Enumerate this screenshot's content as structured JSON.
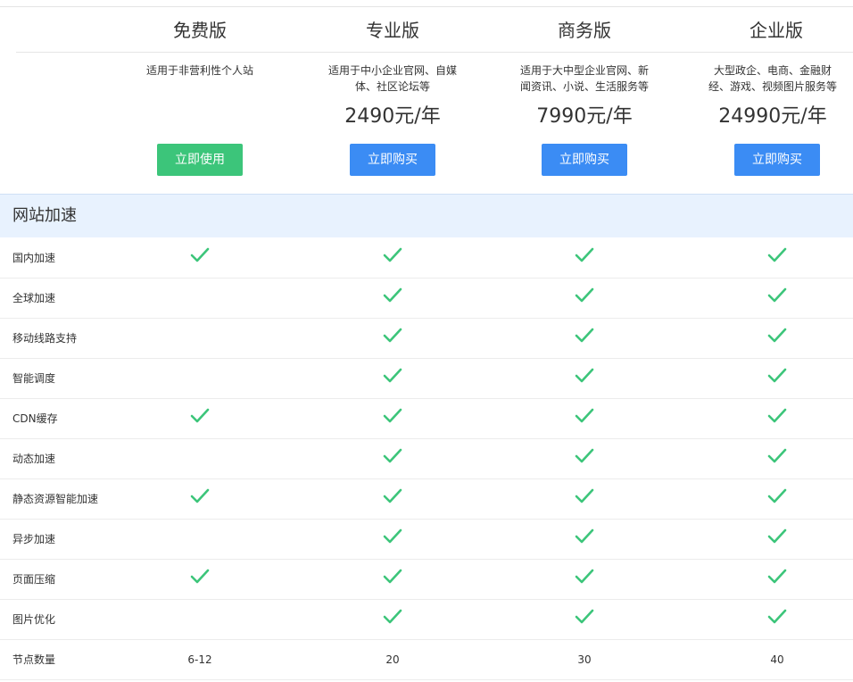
{
  "plans": [
    {
      "name": "免费版",
      "desc_lines": [
        "适用于非营利性个人站"
      ],
      "price": "",
      "button": "立即使用",
      "button_color": "#3cc57a"
    },
    {
      "name": "专业版",
      "desc_lines": [
        "适用于中小企业官网、自媒",
        "体、社区论坛等"
      ],
      "price": "2490元/年",
      "button": "立即购买",
      "button_color": "#3b8cf4"
    },
    {
      "name": "商务版",
      "desc_lines": [
        "适用于大中型企业官网、新",
        "闻资讯、小说、生活服务等"
      ],
      "price": "7990元/年",
      "button": "立即购买",
      "button_color": "#3b8cf4"
    },
    {
      "name": "企业版",
      "desc_lines": [
        "大型政企、电商、金融财",
        "经、游戏、视频图片服务等"
      ],
      "price": "24990元/年",
      "button": "立即购买",
      "button_color": "#3b8cf4"
    }
  ],
  "section": {
    "title": "网站加速",
    "bg_color": "#e8f2fe"
  },
  "check_color": "#3cc57a",
  "check_icon": "check-icon",
  "features": [
    {
      "label": "国内加速",
      "values": [
        true,
        true,
        true,
        true
      ]
    },
    {
      "label": "全球加速",
      "values": [
        false,
        true,
        true,
        true
      ]
    },
    {
      "label": "移动线路支持",
      "values": [
        false,
        true,
        true,
        true
      ]
    },
    {
      "label": "智能调度",
      "values": [
        false,
        true,
        true,
        true
      ]
    },
    {
      "label": "CDN缓存",
      "values": [
        true,
        true,
        true,
        true
      ]
    },
    {
      "label": "动态加速",
      "values": [
        false,
        true,
        true,
        true
      ]
    },
    {
      "label": "静态资源智能加速",
      "values": [
        true,
        true,
        true,
        true
      ]
    },
    {
      "label": "异步加速",
      "values": [
        false,
        true,
        true,
        true
      ]
    },
    {
      "label": "页面压缩",
      "values": [
        true,
        true,
        true,
        true
      ]
    },
    {
      "label": "图片优化",
      "values": [
        false,
        true,
        true,
        true
      ]
    },
    {
      "label": "节点数量",
      "values": [
        "6-12",
        "20",
        "30",
        "40"
      ]
    }
  ]
}
